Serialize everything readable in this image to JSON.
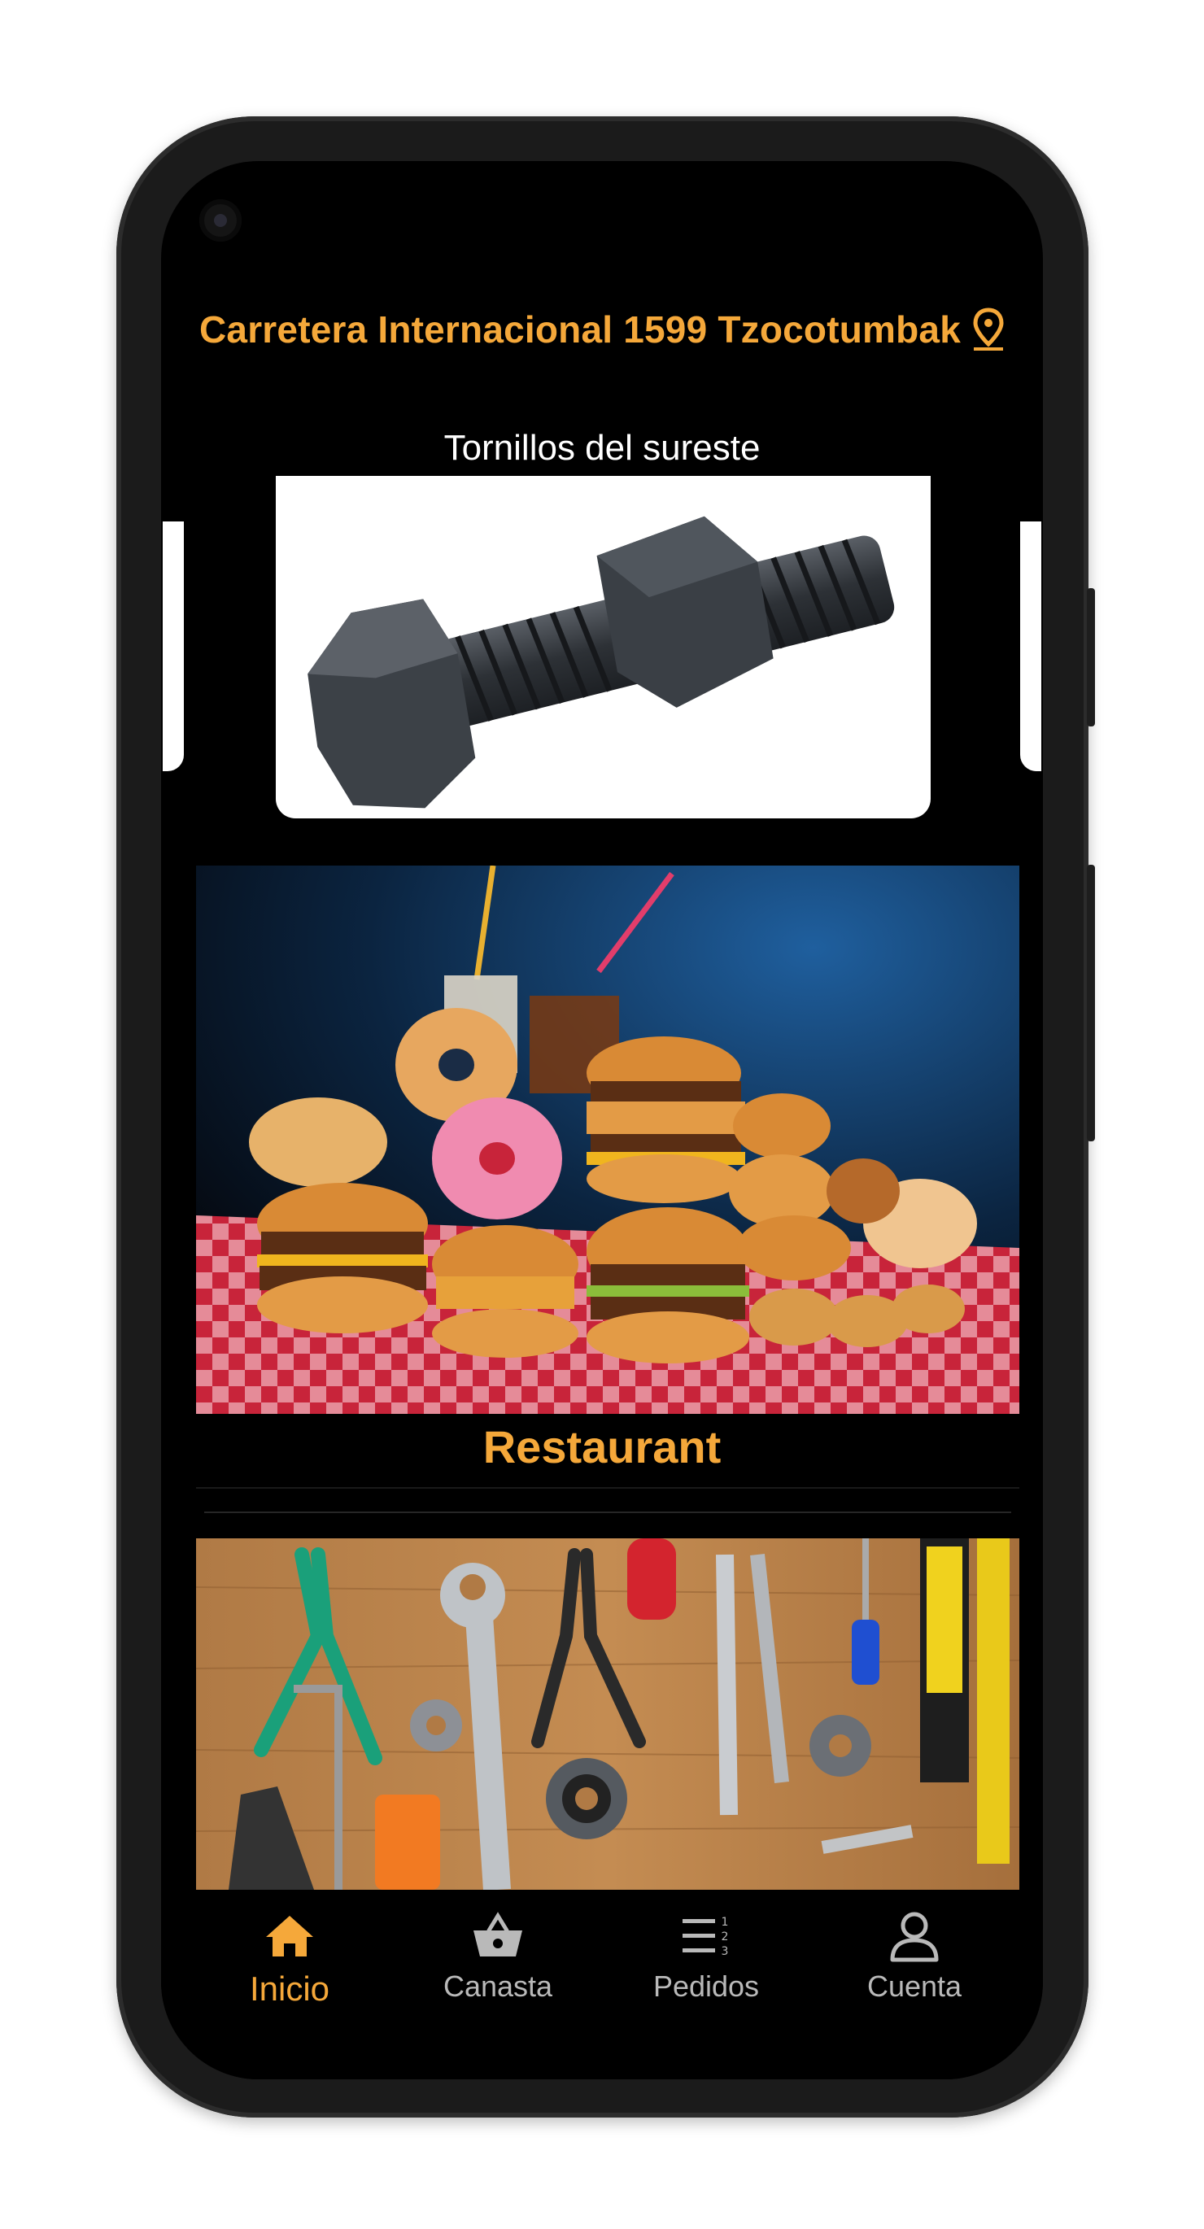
{
  "header": {
    "address": "Carretera Internacional 1599 Tzocotumbak",
    "store_title": "Tornillos del sureste"
  },
  "sections": {
    "restaurant_label": "Restaurant"
  },
  "bottom_nav": {
    "items": [
      {
        "label": "Inicio",
        "icon": "home-icon",
        "active": true
      },
      {
        "label": "Canasta",
        "icon": "basket-icon",
        "active": false
      },
      {
        "label": "Pedidos",
        "icon": "order-list-icon",
        "active": false
      },
      {
        "label": "Cuenta",
        "icon": "account-icon",
        "active": false
      }
    ]
  },
  "colors": {
    "accent": "#f5a83a",
    "background": "#000000",
    "inactive": "#b9b9b9"
  }
}
